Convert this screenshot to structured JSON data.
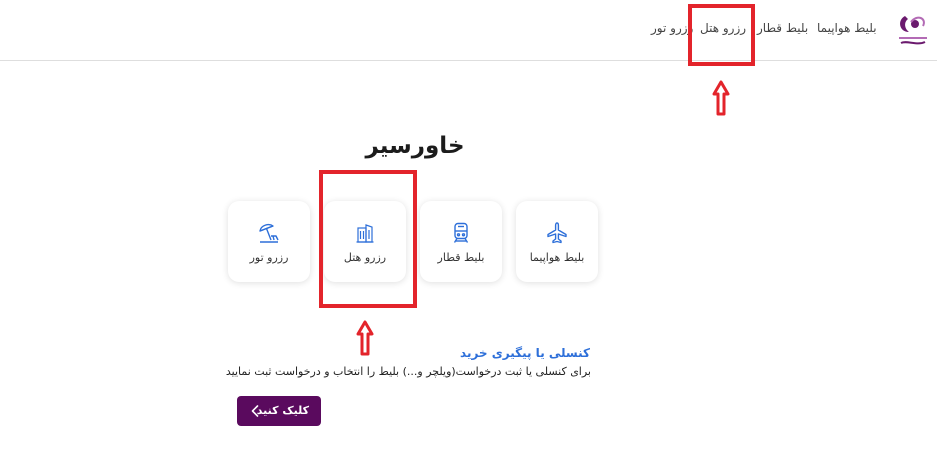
{
  "nav": {
    "items": [
      {
        "id": "flight",
        "label": "بلیط هواپیما"
      },
      {
        "id": "train",
        "label": "بلیط قطار"
      },
      {
        "id": "hotel",
        "label": "رزرو هتل"
      },
      {
        "id": "tour",
        "label": "رزرو تور"
      }
    ],
    "logo_icon": "khavarseir-logo-icon"
  },
  "main": {
    "title": "خاورسیر",
    "cards": [
      {
        "id": "flight",
        "label": "بلیط هواپیما",
        "icon": "airplane-icon"
      },
      {
        "id": "train",
        "label": "بلیط قطار",
        "icon": "train-icon"
      },
      {
        "id": "hotel",
        "label": "رزرو هتل",
        "icon": "building-icon"
      },
      {
        "id": "tour",
        "label": "رزرو تور",
        "icon": "beach-umbrella-icon"
      }
    ]
  },
  "cancel_section": {
    "title": "کنسلی یا پیگیری خرید",
    "description": "برای کنسلی یا ثبت درخواست(ویلچر و...) بلیط را انتخاب و درخواست ثبت نمایید",
    "button_label": "کلیک کنید"
  },
  "colors": {
    "accent_blue": "#2d6fd9",
    "button_purple": "#5a0a5e",
    "highlight_red": "#e3242b"
  }
}
